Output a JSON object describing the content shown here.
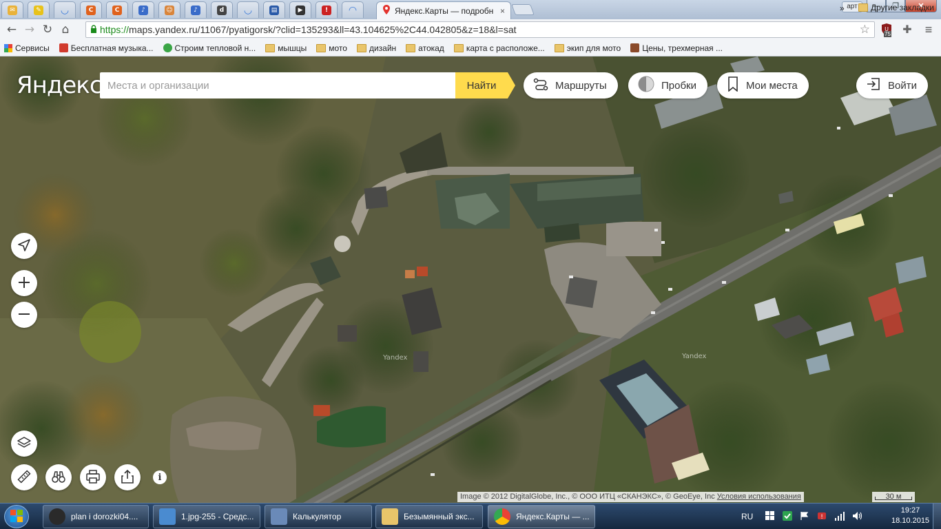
{
  "browser": {
    "tabs": [
      {
        "icon": "mail-icon",
        "color": "#e9b23a",
        "glyph": "✉"
      },
      {
        "icon": "yellow-app-icon",
        "color": "#e8c21a",
        "glyph": "✎"
      },
      {
        "icon": "loading-icon",
        "color": "#ffffff",
        "glyph": "◡"
      },
      {
        "icon": "orange-c-icon",
        "color": "#e0621d",
        "glyph": "C"
      },
      {
        "icon": "orange-c-icon",
        "color": "#e0621d",
        "glyph": "C"
      },
      {
        "icon": "music-icon",
        "color": "#3a6cc9",
        "glyph": "♪"
      },
      {
        "icon": "person-icon",
        "color": "#d9853b",
        "glyph": "☺"
      },
      {
        "icon": "music-icon",
        "color": "#3a6cc9",
        "glyph": "♪"
      },
      {
        "icon": "dark-app-icon",
        "color": "#444444",
        "glyph": "d"
      },
      {
        "icon": "loading-icon",
        "color": "#ffffff",
        "glyph": "◡"
      },
      {
        "icon": "calculator-icon",
        "color": "#2a5aa8",
        "glyph": "▤"
      },
      {
        "icon": "play-icon",
        "color": "#333333",
        "glyph": "▶"
      },
      {
        "icon": "warning-icon",
        "color": "#cc2222",
        "glyph": "!"
      },
      {
        "icon": "loading-icon",
        "color": "#ffffff",
        "glyph": "◠"
      }
    ],
    "active_tab": {
      "title": "Яндекс.Карты — подробн",
      "close": "×"
    },
    "user": "арт",
    "window_buttons": {
      "minimize": "—",
      "maximize": "❐",
      "close": "✕"
    },
    "url": {
      "scheme": "https://",
      "rest": "maps.yandex.ru/11067/pyatigorsk/?clid=135293&ll=43.104625%2C44.042805&z=18&l=sat"
    },
    "ext_badge": "75",
    "bookmarks": [
      {
        "label": "Сервисы",
        "icon": "apps-icon"
      },
      {
        "label": "Бесплатная музыка...",
        "icon": "music-site-icon"
      },
      {
        "label": "Строим тепловой н...",
        "icon": "chrome-site-icon"
      },
      {
        "label": "мышцы",
        "icon": "folder-icon"
      },
      {
        "label": "мото",
        "icon": "folder-icon"
      },
      {
        "label": "дизайн",
        "icon": "folder-icon"
      },
      {
        "label": "атокад",
        "icon": "folder-icon"
      },
      {
        "label": "карта с расположе...",
        "icon": "folder-icon"
      },
      {
        "label": "экип для мото",
        "icon": "folder-icon"
      },
      {
        "label": "Цены, трехмерная ...",
        "icon": "animal-site-icon"
      }
    ],
    "bookmarks_more": "»",
    "other_bookmarks": "Другие закладки"
  },
  "map": {
    "logo": "Яндекс",
    "search_placeholder": "Места и организации",
    "find_button": "Найти",
    "routes": "Маршруты",
    "traffic": "Пробки",
    "my_places": "Мои места",
    "login": "Войти",
    "copyright": "Image © 2012 DigitalGlobe, Inc., © ООО ИТЦ «СКАНЭКС», © GeoEye, Inc",
    "terms": "Условия использования",
    "scale": "30 м",
    "info": "i",
    "watermark": "Yandex"
  },
  "taskbar": {
    "items": [
      {
        "label": "plan i dorozki04....",
        "icon": "app-icon"
      },
      {
        "label": "1.jpg-255 - Средс...",
        "icon": "image-viewer-icon"
      },
      {
        "label": "Калькулятор",
        "icon": "calculator-icon"
      },
      {
        "label": "Безымянный экс...",
        "icon": "folder-icon"
      },
      {
        "label": "Яндекс.Карты — ...",
        "icon": "chrome-icon"
      }
    ],
    "language": "RU",
    "time": "19:27",
    "date": "18.10.2015"
  },
  "colors": {
    "accent_yellow": "#ffdb4d",
    "https_green": "#1a8a1a",
    "taskbar": "#1d3350"
  }
}
